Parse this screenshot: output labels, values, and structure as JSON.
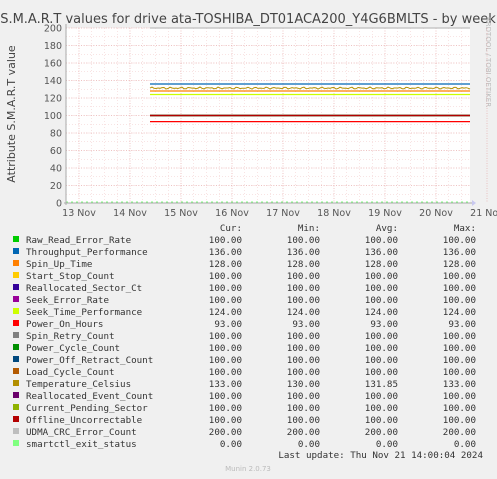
{
  "chart_data": {
    "type": "line",
    "title": "S.M.A.R.T values for drive ata-TOSHIBA_DT01ACA200_Y4G6BMLTS - by week",
    "ylabel": "Attribute S.M.A.R.T value",
    "xlabel": "",
    "ylim": [
      0,
      200
    ],
    "yticks": [
      0,
      20,
      40,
      60,
      80,
      100,
      120,
      140,
      160,
      180,
      200
    ],
    "x_categories": [
      "13 Nov",
      "14 Nov",
      "15 Nov",
      "16 Nov",
      "17 Nov",
      "18 Nov",
      "19 Nov",
      "20 Nov",
      "21 Nov"
    ],
    "data_start_category": "14 Nov",
    "watermark": "RRDTOOL / TOBI OETIKER",
    "legend_headers": [
      "Cur:",
      "Min:",
      "Avg:",
      "Max:"
    ],
    "series": [
      {
        "name": "Raw_Read_Error_Rate",
        "color": "#00cc00",
        "cur": "100.00",
        "min": "100.00",
        "avg": "100.00",
        "max": "100.00",
        "value": 100
      },
      {
        "name": "Throughput_Performance",
        "color": "#0066b3",
        "cur": "136.00",
        "min": "136.00",
        "avg": "136.00",
        "max": "136.00",
        "value": 136
      },
      {
        "name": "Spin_Up_Time",
        "color": "#ff8000",
        "cur": "128.00",
        "min": "128.00",
        "avg": "128.00",
        "max": "128.00",
        "value": 128
      },
      {
        "name": "Start_Stop_Count",
        "color": "#ffcc00",
        "cur": "100.00",
        "min": "100.00",
        "avg": "100.00",
        "max": "100.00",
        "value": 100
      },
      {
        "name": "Reallocated_Sector_Ct",
        "color": "#330099",
        "cur": "100.00",
        "min": "100.00",
        "avg": "100.00",
        "max": "100.00",
        "value": 100
      },
      {
        "name": "Seek_Error_Rate",
        "color": "#990099",
        "cur": "100.00",
        "min": "100.00",
        "avg": "100.00",
        "max": "100.00",
        "value": 100
      },
      {
        "name": "Seek_Time_Performance",
        "color": "#ccff00",
        "cur": "124.00",
        "min": "124.00",
        "avg": "124.00",
        "max": "124.00",
        "value": 124
      },
      {
        "name": "Power_On_Hours",
        "color": "#ff0000",
        "cur": "93.00",
        "min": "93.00",
        "avg": "93.00",
        "max": "93.00",
        "value": 93
      },
      {
        "name": "Spin_Retry_Count",
        "color": "#808080",
        "cur": "100.00",
        "min": "100.00",
        "avg": "100.00",
        "max": "100.00",
        "value": 100
      },
      {
        "name": "Power_Cycle_Count",
        "color": "#008f00",
        "cur": "100.00",
        "min": "100.00",
        "avg": "100.00",
        "max": "100.00",
        "value": 100
      },
      {
        "name": "Power_Off_Retract_Count",
        "color": "#00487d",
        "cur": "100.00",
        "min": "100.00",
        "avg": "100.00",
        "max": "100.00",
        "value": 100
      },
      {
        "name": "Load_Cycle_Count",
        "color": "#b35a00",
        "cur": "100.00",
        "min": "100.00",
        "avg": "100.00",
        "max": "100.00",
        "value": 100
      },
      {
        "name": "Temperature_Celsius",
        "color": "#b38f00",
        "cur": "133.00",
        "min": "130.00",
        "avg": "131.85",
        "max": "133.00",
        "value": 132
      },
      {
        "name": "Reallocated_Event_Count",
        "color": "#6b006b",
        "cur": "100.00",
        "min": "100.00",
        "avg": "100.00",
        "max": "100.00",
        "value": 100
      },
      {
        "name": "Current_Pending_Sector",
        "color": "#8fb300",
        "cur": "100.00",
        "min": "100.00",
        "avg": "100.00",
        "max": "100.00",
        "value": 100
      },
      {
        "name": "Offline_Uncorrectable",
        "color": "#b30000",
        "cur": "100.00",
        "min": "100.00",
        "avg": "100.00",
        "max": "100.00",
        "value": 100
      },
      {
        "name": "UDMA_CRC_Error_Count",
        "color": "#bebebe",
        "cur": "200.00",
        "min": "200.00",
        "avg": "200.00",
        "max": "200.00",
        "value": 200
      },
      {
        "name": "smartctl_exit_status",
        "color": "#80ff80",
        "cur": "0.00",
        "min": "0.00",
        "avg": "0.00",
        "max": "0.00",
        "value": 0
      }
    ],
    "last_update": "Last update: Thu Nov 21 14:00:04 2024",
    "footer": "Munin 2.0.73"
  }
}
